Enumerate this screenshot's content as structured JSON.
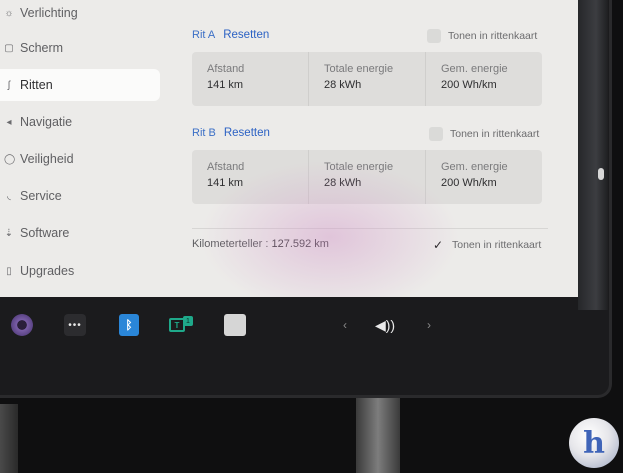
{
  "sidebar": {
    "items": [
      {
        "label": "Verlichting",
        "icon": "lightbulb-icon",
        "glyph": "☼"
      },
      {
        "label": "Scherm",
        "icon": "display-icon",
        "glyph": "▢"
      },
      {
        "label": "Ritten",
        "icon": "trips-icon",
        "glyph": "ʃ"
      },
      {
        "label": "Navigatie",
        "icon": "navigation-icon",
        "glyph": "◂"
      },
      {
        "label": "Veiligheid",
        "icon": "shield-icon",
        "glyph": "◯"
      },
      {
        "label": "Service",
        "icon": "wrench-icon",
        "glyph": "◟"
      },
      {
        "label": "Software",
        "icon": "download-icon",
        "glyph": "⇣"
      },
      {
        "label": "Upgrades",
        "icon": "bag-icon",
        "glyph": "▯"
      }
    ],
    "active": "Ritten"
  },
  "trip_a": {
    "name": "Rit A",
    "reset_label": "Resetten",
    "toggle_label": "Tonen in rittenkaart",
    "toggle_checked": false,
    "stats": [
      {
        "label": "Afstand",
        "value": "141 km"
      },
      {
        "label": "Totale energie",
        "value": "28 kWh"
      },
      {
        "label": "Gem. energie",
        "value": "200 Wh/km"
      }
    ]
  },
  "trip_b": {
    "name": "Rit B",
    "reset_label": "Resetten",
    "toggle_label": "Tonen in rittenkaart",
    "toggle_checked": false,
    "stats": [
      {
        "label": "Afstand",
        "value": "141 km"
      },
      {
        "label": "Totale energie",
        "value": "28 kWh"
      },
      {
        "label": "Gem. energie",
        "value": "200 Wh/km"
      }
    ]
  },
  "odometer": {
    "label": "Kilometerteller :",
    "value": "127.592 km",
    "toggle_label": "Tonen in rittenkaart",
    "toggle_checked": true,
    "check_glyph": "✓"
  },
  "taskbar": {
    "dots_glyph": "•••",
    "bluetooth_glyph": "ᛒ",
    "apps_glyph_1": "T",
    "apps_glyph_2": "1",
    "prev_glyph": "‹",
    "volume_glyph": "◀))",
    "next_glyph": "›"
  },
  "logo": {
    "glyph": "h"
  },
  "colors": {
    "accent_blue": "#2c62c4",
    "screen_bg": "#ecebe9",
    "card_bg": "#dedddb",
    "bluetooth": "#2a86d8",
    "app_green": "#1fa98a"
  }
}
